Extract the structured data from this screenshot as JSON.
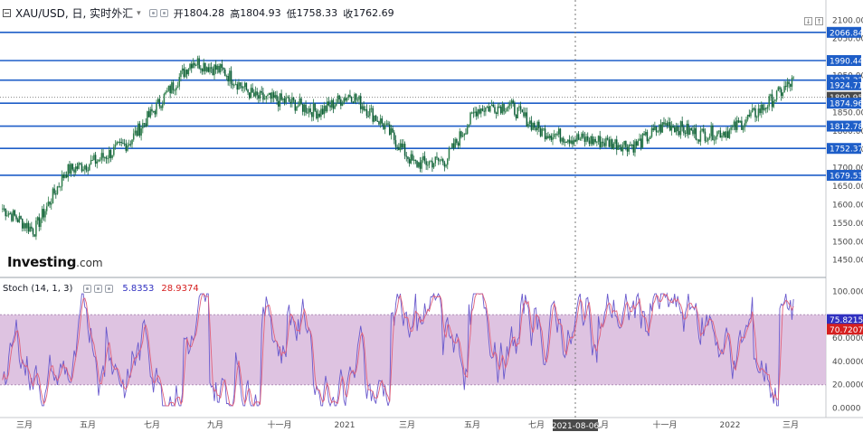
{
  "header": {
    "symbol": "XAU/USD, 日, 实时外汇",
    "open_label": "开",
    "open": "1804.28",
    "high_label": "高",
    "high": "1804.93",
    "low_label": "低",
    "low": "1758.33",
    "close_label": "收",
    "close": "1762.69",
    "collapse_icon": "minus-box-icon",
    "chevron_icon": "chevron-down-icon"
  },
  "indicator": {
    "name": "Stoch (14, 1, 3)",
    "k_value": "5.8353",
    "d_value": "28.9374",
    "k_color": "#3030c0",
    "d_color": "#d62020"
  },
  "logo": {
    "brand": "Investing",
    "suffix": ".com"
  },
  "colors": {
    "up": "#2e7d4a",
    "down": "#0f5e3a",
    "hline": "#1e5ec8",
    "band": "#d8b8dc",
    "stoch_k": "#6a5acd",
    "stoch_d": "#e0607a"
  },
  "price_scale": {
    "ticks": [
      "2100.00",
      "2050.00",
      "1950.00",
      "1850.00",
      "1800.00",
      "1750.00",
      "1700.00",
      "1650.00",
      "1600.00",
      "1550.00",
      "1500.00",
      "1450.00"
    ],
    "labels": [
      "2066.84",
      "1990.44",
      "1937.32",
      "1924.71",
      "1890.95",
      "1874.96",
      "1812.78",
      "1752.37",
      "1679.53"
    ],
    "dark_label": "1890.95"
  },
  "stoch_scale": {
    "ticks": [
      "100.0000",
      "60.0000",
      "40.0000",
      "20.0000",
      "0.0000"
    ],
    "k_label": "75.8215",
    "d_label": "70.7207"
  },
  "time_axis": {
    "labels": [
      "三月",
      "五月",
      "七月",
      "九月",
      "十一月",
      "2021",
      "三月",
      "五月",
      "七月",
      "九月",
      "十一月",
      "2022",
      "三月"
    ],
    "cursor_label": "2021-08-06"
  },
  "chart_data": [
    {
      "type": "candlestick",
      "title": "XAU/USD, 日, 实时外汇",
      "ylim": [
        1415,
        2130
      ],
      "x": [
        "2020-02-01",
        "2020-03-01",
        "2020-04-01",
        "2020-05-01",
        "2020-06-01",
        "2020-07-01",
        "2020-08-01",
        "2020-09-01",
        "2020-10-01",
        "2020-11-01",
        "2020-12-01",
        "2021-01-01",
        "2021-02-01",
        "2021-03-01",
        "2021-04-01",
        "2021-05-01",
        "2021-06-01",
        "2021-07-01",
        "2021-08-01",
        "2021-09-01",
        "2021-10-01",
        "2021-11-01",
        "2021-12-01",
        "2022-01-01",
        "2022-02-01",
        "2022-03-01"
      ],
      "close": [
        1590,
        1530,
        1690,
        1720,
        1770,
        1880,
        1990,
        1960,
        1890,
        1880,
        1850,
        1900,
        1820,
        1710,
        1720,
        1860,
        1870,
        1800,
        1780,
        1770,
        1760,
        1820,
        1790,
        1800,
        1860,
        1935
      ],
      "horizontal_lines": [
        2066.84,
        1990.44,
        1937.32,
        1874.96,
        1812.78,
        1752.37,
        1679.53
      ],
      "price_labels": [
        2066.84,
        1990.44,
        1937.32,
        1924.71,
        1890.95,
        1874.96,
        1812.78,
        1752.37,
        1679.53
      ],
      "last_ohlc": {
        "open": 1804.28,
        "high": 1804.93,
        "low": 1758.33,
        "close": 1762.69
      }
    },
    {
      "type": "line",
      "title": "Stoch (14, 1, 3)",
      "ylim": [
        -5,
        105
      ],
      "band": [
        20,
        80
      ],
      "series": [
        {
          "name": "%K",
          "last": 5.8353
        },
        {
          "name": "%D",
          "last": 28.9374
        }
      ],
      "axis_labels": {
        "k": 75.8215,
        "d": 70.7207
      }
    }
  ]
}
